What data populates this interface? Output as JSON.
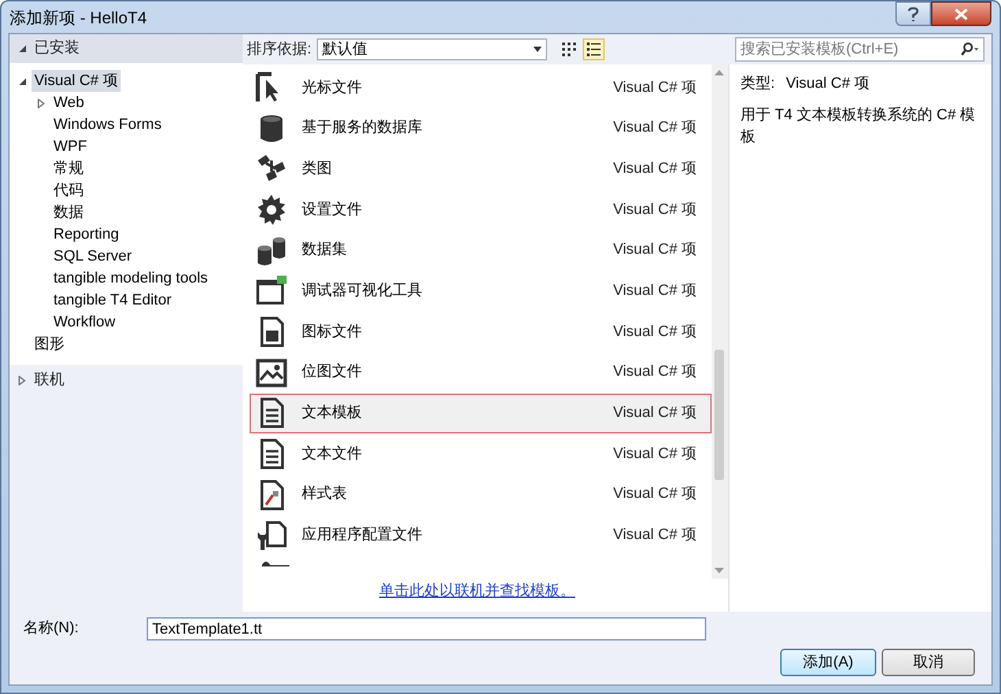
{
  "window": {
    "title": "添加新项 - HelloT4"
  },
  "sidebar": {
    "sections": [
      {
        "label": "已安装",
        "expanded": true,
        "children": [
          {
            "label": "Visual C# 项",
            "selected": true,
            "expanded": true,
            "children": [
              {
                "label": "Web",
                "selected": false,
                "expanded": false
              },
              {
                "label": "Windows Forms",
                "selected": false
              },
              {
                "label": "WPF",
                "selected": false
              },
              {
                "label": "常规",
                "selected": false
              },
              {
                "label": "代码",
                "selected": false
              },
              {
                "label": "数据",
                "selected": false
              },
              {
                "label": "Reporting",
                "selected": false
              },
              {
                "label": "SQL Server",
                "selected": false
              },
              {
                "label": "tangible modeling tools",
                "selected": false
              },
              {
                "label": "tangible T4 Editor",
                "selected": false
              },
              {
                "label": "Workflow",
                "selected": false
              }
            ]
          },
          {
            "label": "图形",
            "selected": false
          }
        ]
      },
      {
        "label": "联机",
        "expanded": false
      }
    ]
  },
  "toolbar": {
    "sort_label": "排序依据:",
    "sort_value": "默认值",
    "views": [
      {
        "kind": "grid",
        "selected": false
      },
      {
        "kind": "list",
        "selected": true
      }
    ]
  },
  "templates": [
    {
      "kind": "cursor",
      "name": "光标文件",
      "type": "Visual C# 项",
      "selected": false
    },
    {
      "kind": "database",
      "name": "基于服务的数据库",
      "type": "Visual C# 项",
      "selected": false
    },
    {
      "kind": "classdiagram",
      "name": "类图",
      "type": "Visual C# 项",
      "selected": false
    },
    {
      "kind": "gear",
      "name": "设置文件",
      "type": "Visual C# 项",
      "selected": false
    },
    {
      "kind": "dataset",
      "name": "数据集",
      "type": "Visual C# 项",
      "selected": false
    },
    {
      "kind": "window",
      "name": "调试器可视化工具",
      "type": "Visual C# 项",
      "selected": false
    },
    {
      "kind": "iconfile",
      "name": "图标文件",
      "type": "Visual C# 项",
      "selected": false
    },
    {
      "kind": "picture",
      "name": "位图文件",
      "type": "Visual C# 项",
      "selected": false
    },
    {
      "kind": "document",
      "name": "文本模板",
      "type": "Visual C# 项",
      "selected": true
    },
    {
      "kind": "document",
      "name": "文本文件",
      "type": "Visual C# 项",
      "selected": false
    },
    {
      "kind": "stylesheet",
      "name": "样式表",
      "type": "Visual C# 项",
      "selected": false
    },
    {
      "kind": "config",
      "name": "应用程序配置文件",
      "type": "Visual C# 项",
      "selected": false
    }
  ],
  "online_link": "单击此处以联机并查找模板。",
  "search": {
    "placeholder": "搜索已安装模板(Ctrl+E)"
  },
  "details": {
    "type_label": "类型:",
    "type_value": "Visual C# 项",
    "description": "用于 T4 文本模板转换系统的 C# 模板"
  },
  "name_field": {
    "label": "名称(N):",
    "value": "TextTemplate1.tt"
  },
  "buttons": [
    {
      "kind": "primary",
      "label": "添加(A)"
    },
    {
      "kind": "secondary",
      "label": "取消"
    }
  ]
}
